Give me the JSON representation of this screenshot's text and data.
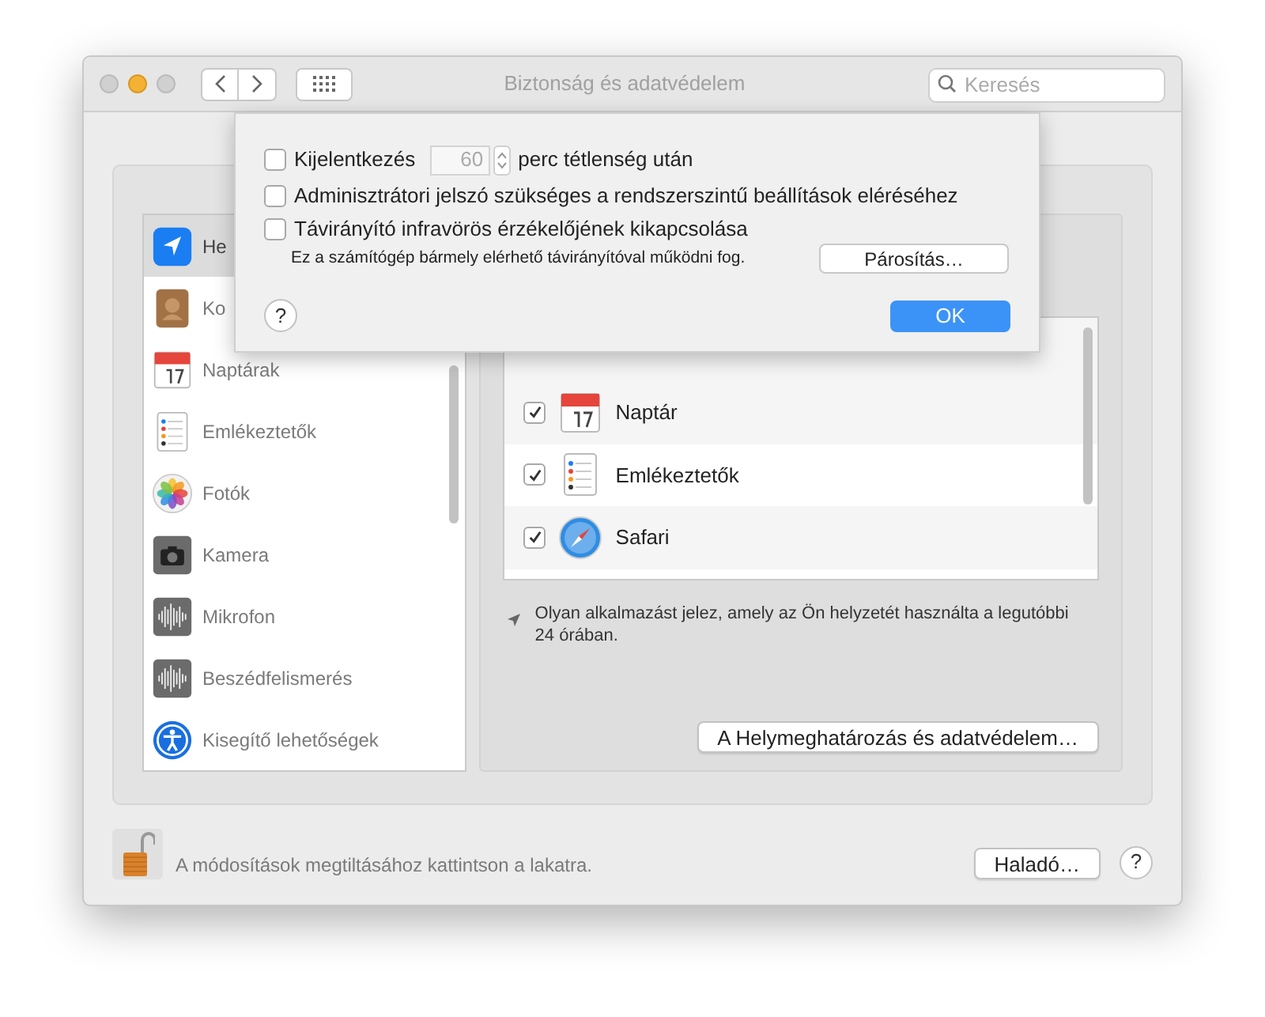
{
  "window": {
    "title": "Biztonság és adatvédelem",
    "search": {
      "placeholder": "Keresés"
    }
  },
  "sheet": {
    "options": [
      {
        "kind": "stepper",
        "label": "Kijelentkezés",
        "value": "60",
        "suffix": "perc tétlenség után",
        "checked": false
      },
      {
        "kind": "plain",
        "label": "Adminisztrátori jelszó szükséges a rendszerszintű beállítások eléréséhez",
        "checked": false
      },
      {
        "kind": "note",
        "label": "Távirányító infravörös érzékelőjének kikapcsolása",
        "note": "Ez a számítógép bármely elérhető távirányítóval működni fog.",
        "button": "Párosítás…",
        "checked": false
      }
    ],
    "help": "?",
    "ok": "OK"
  },
  "sidebar": {
    "items": [
      {
        "label": "He",
        "kind": "location",
        "selected": true
      },
      {
        "label": "Ko",
        "kind": "contacts",
        "selected": false
      },
      {
        "label": "Naptárak",
        "kind": "calendar",
        "selected": false
      },
      {
        "label": "Emlékeztetők",
        "kind": "reminders",
        "selected": false
      },
      {
        "label": "Fotók",
        "kind": "photos",
        "selected": false
      },
      {
        "label": "Kamera",
        "kind": "camera",
        "selected": false
      },
      {
        "label": "Mikrofon",
        "kind": "mic",
        "selected": false
      },
      {
        "label": "Beszédfelismerés",
        "kind": "mic",
        "selected": false
      },
      {
        "label": "Kisegítő lehetőségek",
        "kind": "accessibility",
        "selected": false
      }
    ]
  },
  "apps": {
    "rows": [
      {
        "name": "Naptár",
        "kind": "calendar",
        "checked": true
      },
      {
        "name": "Emlékeztetők",
        "kind": "reminders",
        "checked": true
      },
      {
        "name": "Safari",
        "kind": "safari",
        "checked": true
      }
    ]
  },
  "location_note": "Olyan alkalmazást jelez, amely az Ön helyzetét használta a legutóbbi 24 órában.",
  "details_button": "A Helymeghatározás és adatvédelem…",
  "footer": {
    "lock_text": "A módosítások megtiltásához kattintson a lakatra.",
    "advanced_button": "Haladó…",
    "help": "?"
  }
}
